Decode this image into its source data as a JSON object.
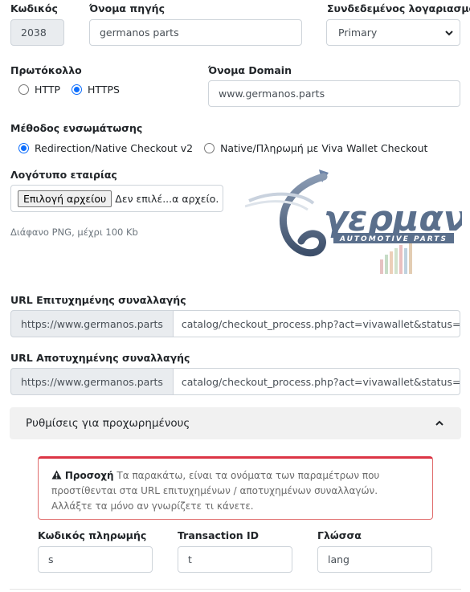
{
  "fields": {
    "code": {
      "label": "Κωδικός",
      "value": "2038"
    },
    "source_name": {
      "label": "Όνομα πηγής",
      "value": "germanos parts"
    },
    "account": {
      "label": "Συνδεδεμένος λογαριασμός",
      "value": "Primary"
    },
    "protocol": {
      "label": "Πρωτόκολλο",
      "options": [
        "HTTP",
        "HTTPS"
      ],
      "selected": "HTTPS"
    },
    "domain": {
      "label": "Όνομα Domain",
      "value": "www.germanos.parts"
    },
    "integration": {
      "label": "Μέθοδος ενσωμάτωσης",
      "options": [
        "Redirection/Native Checkout v2",
        "Native/Πληρωμή με Viva Wallet Checkout"
      ],
      "selected": "Redirection/Native Checkout v2"
    },
    "logo": {
      "label": "Λογότυπο εταιρίας",
      "button": "Επιλογή αρχείου",
      "status": "Δεν επιλέ...α αρχείο.",
      "help": "Διάφανο PNG, μέχρι 100 Kb"
    },
    "success_url": {
      "label": "URL Επιτυχημένης συναλλαγής",
      "prefix": "https://www.germanos.parts",
      "value": "catalog/checkout_process.php?act=vivawallet&status=s"
    },
    "failure_url": {
      "label": "URL Αποτυχημένης συναλλαγής",
      "prefix": "https://www.germanos.parts",
      "value": "catalog/checkout_process.php?act=vivawallet&status=fa"
    }
  },
  "logo_image": {
    "brand": "γερμανός",
    "tagline": "AUTOMOTIVE PARTS"
  },
  "advanced": {
    "title": "Ρυθμίσεις για προχωρημένους",
    "alert_strong": "Προσοχή",
    "alert_text": "Τα παρακάτω, είναι τα ονόματα των παραμέτρων που προστίθενται στα URL επιτυχημένων / αποτυχημένων συναλλαγών. Αλλάξτε τα μόνο αν γνωρίζετε τι κάνετε.",
    "payment_code": {
      "label": "Κωδικός πληρωμής",
      "value": "s"
    },
    "transaction_id": {
      "label": "Transaction ID",
      "value": "t"
    },
    "language": {
      "label": "Γλώσσα",
      "value": "lang"
    }
  },
  "colors": {
    "accent": "#0d6efd",
    "alert": "#dc3545",
    "logo_blue": "#5a6f8c"
  }
}
